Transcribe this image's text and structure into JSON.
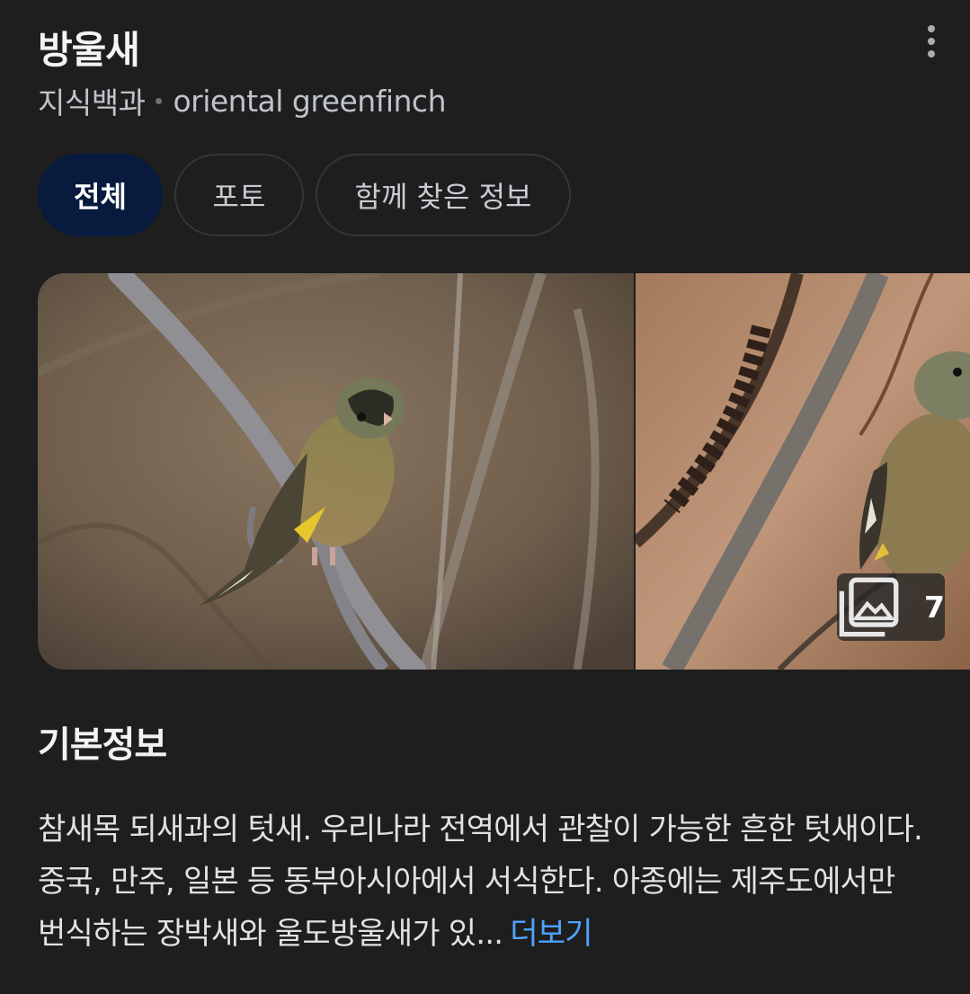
{
  "header": {
    "title": "방울새",
    "source": "지식백과",
    "english_name": "oriental greenfinch"
  },
  "tabs": [
    {
      "label": "전체",
      "active": true
    },
    {
      "label": "포토",
      "active": false
    },
    {
      "label": "함께 찾은 정보",
      "active": false
    }
  ],
  "gallery": {
    "photo_count": "7",
    "badge_icon": "image-stack-icon"
  },
  "basic_info": {
    "title": "기본정보",
    "description": "참새목 되새과의 텃새. 우리나라 전역에서 관찰이 가능한 흔한 텃새이다. 중국, 만주, 일본 등 동부아시아에서 서식한다. 아종에는 제주도에서만 번식하는 장박새와 울도방울새가 있...",
    "more_label": "더보기"
  },
  "colors": {
    "background": "#1e1e1f",
    "active_tab": "#081a3d",
    "link": "#4ea4ff"
  }
}
